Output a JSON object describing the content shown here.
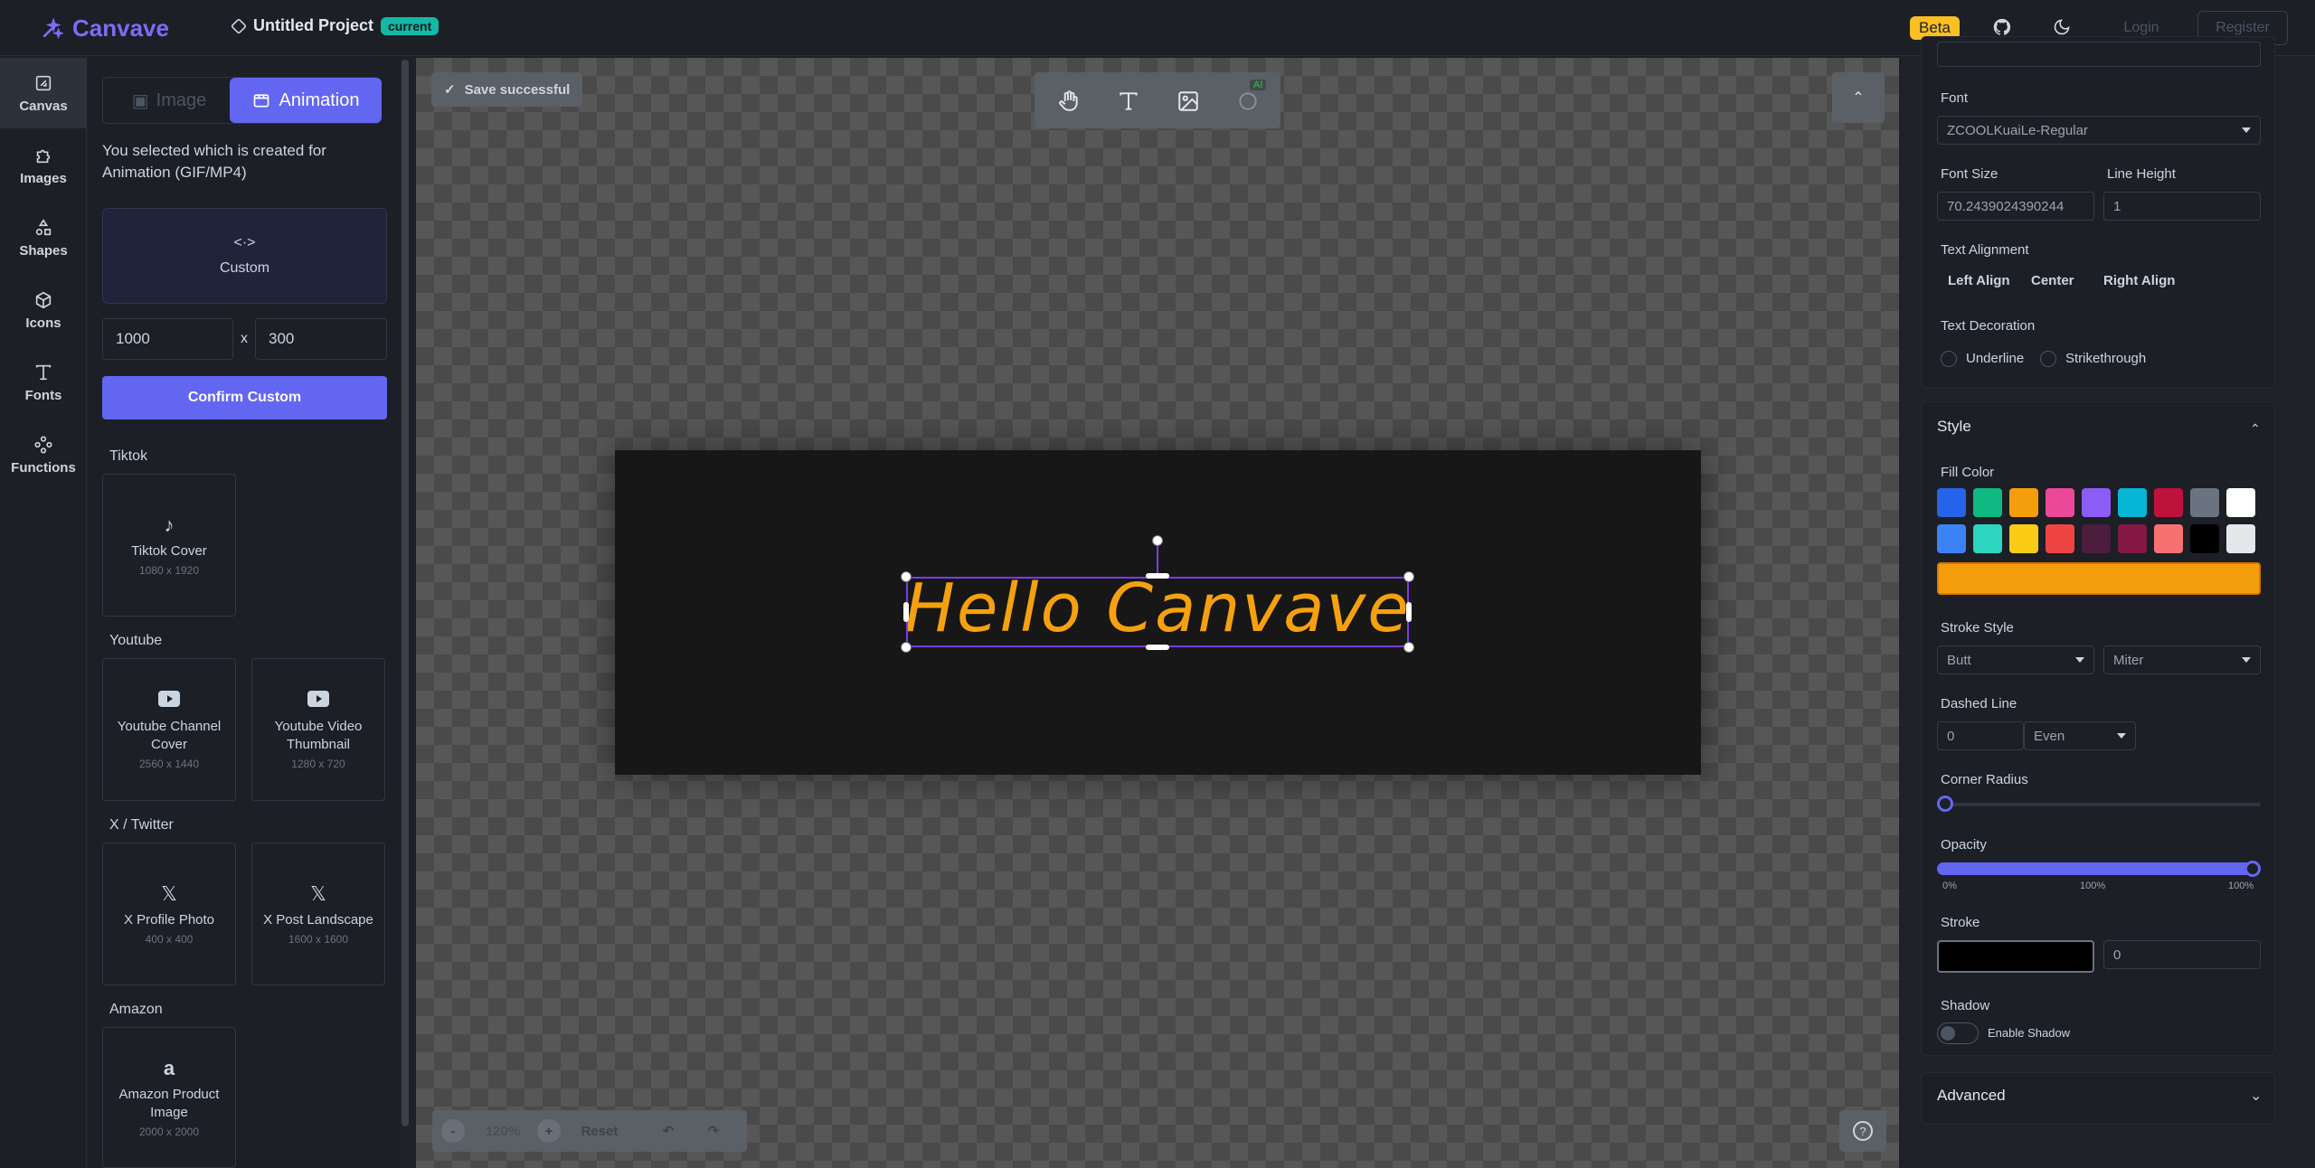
{
  "app": {
    "name": "Canvave",
    "project_title": "Untitled Project",
    "project_badge": "current",
    "beta": "Beta",
    "login": "Login",
    "register": "Register"
  },
  "rail": [
    {
      "label": "Canvas",
      "icon": "canvas-icon"
    },
    {
      "label": "Images",
      "icon": "puzzle-icon"
    },
    {
      "label": "Shapes",
      "icon": "shapes-icon"
    },
    {
      "label": "Icons",
      "icon": "box-icon"
    },
    {
      "label": "Fonts",
      "icon": "type-icon"
    },
    {
      "label": "Functions",
      "icon": "functions-icon"
    }
  ],
  "panel": {
    "tab_image": "Image",
    "tab_animation": "Animation",
    "selected_text": "You selected which is created for Animation (GIF/MP4)",
    "custom_label": "Custom",
    "width": "1000",
    "height": "300",
    "x": "x",
    "confirm": "Confirm Custom",
    "sections": [
      {
        "title": "Tiktok",
        "cards": [
          {
            "name": "Tiktok Cover",
            "size": "1080 x 1920",
            "icon": "tiktok-icon"
          }
        ]
      },
      {
        "title": "Youtube",
        "cards": [
          {
            "name": "Youtube Channel Cover",
            "size": "2560 x 1440",
            "icon": "youtube-icon"
          },
          {
            "name": "Youtube Video Thumbnail",
            "size": "1280 x 720",
            "icon": "youtube-icon"
          }
        ]
      },
      {
        "title": "X / Twitter",
        "cards": [
          {
            "name": "X Profile Photo",
            "size": "400 x 400",
            "icon": "x-icon"
          },
          {
            "name": "X Post Landscape",
            "size": "1600 x 1600",
            "icon": "x-icon"
          }
        ]
      },
      {
        "title": "Amazon",
        "cards": [
          {
            "name": "Amazon Product Image",
            "size": "2000 x 2000",
            "icon": "amazon-icon"
          }
        ]
      }
    ]
  },
  "canvas": {
    "toast": "Save successful",
    "ai_tag": "AI",
    "text": "Hello Canvave",
    "text_color": "#f5a10f",
    "zoom": "120%",
    "reset": "Reset"
  },
  "props": {
    "font_label": "Font",
    "font_value": "ZCOOLKuaiLe-Regular",
    "font_size_label": "Font Size",
    "font_size_value": "70.2439024390244",
    "line_height_label": "Line Height",
    "line_height_value": "1",
    "text_alignment_label": "Text Alignment",
    "align_left": "Left Align",
    "align_center": "Center",
    "align_right": "Right Align",
    "text_decoration_label": "Text Decoration",
    "underline": "Underline",
    "strikethrough": "Strikethrough",
    "style_title": "Style",
    "fill_color_label": "Fill Color",
    "fill_colors_row1": [
      "#2563eb",
      "#10b981",
      "#f59e0b",
      "#ec4899",
      "#8b5cf6",
      "#06b6d4",
      "#be123c",
      "#6b7280",
      "#ffffff"
    ],
    "fill_colors_row2": [
      "#3b82f6",
      "#2dd4bf",
      "#facc15",
      "#ef4444",
      "#4c1d3d",
      "#831843",
      "#f87171",
      "#000000",
      "#e5e7eb"
    ],
    "fill_selected": "#f59e0b",
    "stroke_style_label": "Stroke Style",
    "stroke_cap": "Butt",
    "stroke_join": "Miter",
    "dashed_label": "Dashed Line",
    "dashed_value": "0",
    "dashed_mode": "Even",
    "corner_radius_label": "Corner Radius",
    "corner_radius_value": 0,
    "opacity_label": "Opacity",
    "opacity_value": 1.0,
    "opacity_ticks": [
      "0%",
      "100%",
      "100%"
    ],
    "stroke_label": "Stroke",
    "stroke_color": "#000000",
    "stroke_width": "0",
    "shadow_label": "Shadow",
    "shadow_toggle": "Enable Shadow",
    "advanced_title": "Advanced"
  }
}
